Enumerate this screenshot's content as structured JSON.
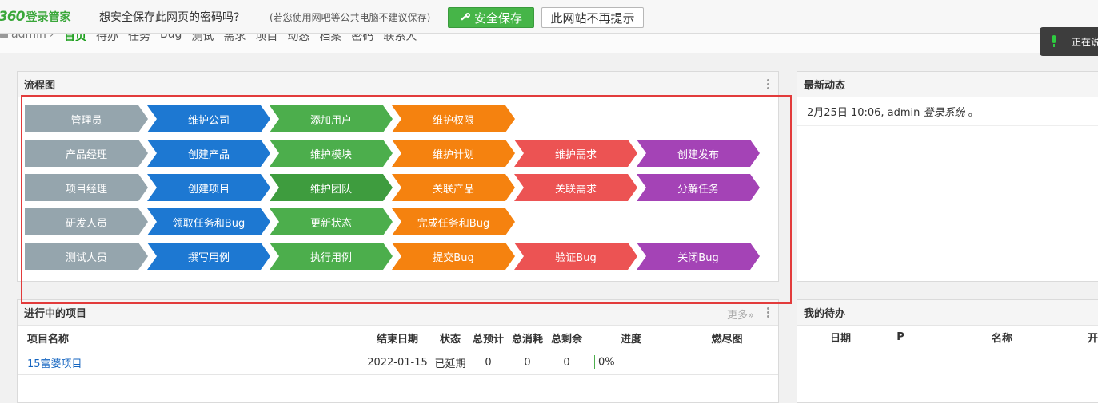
{
  "password_bar": {
    "logo_num": "360",
    "logo_text": "登录管家",
    "ask": "想安全保存此网页的密码吗?",
    "hint": "(若您使用网吧等公共电脑不建议保存)",
    "save_label": "安全保存",
    "never_label": "此网站不再提示"
  },
  "voice_widget": {
    "text": "正在说"
  },
  "nav": {
    "user": "admin",
    "separator": "›",
    "items": [
      "首页",
      "待办",
      "任务",
      "Bug",
      "测试",
      "需求",
      "项目",
      "动态",
      "档案",
      "密码",
      "联系人"
    ]
  },
  "flow_panel": {
    "title": "流程图",
    "rows": [
      {
        "steps": [
          {
            "label": "管理员",
            "color": "gray"
          },
          {
            "label": "维护公司",
            "color": "blue"
          },
          {
            "label": "添加用户",
            "color": "green"
          },
          {
            "label": "维护权限",
            "color": "orange"
          }
        ]
      },
      {
        "steps": [
          {
            "label": "产品经理",
            "color": "gray"
          },
          {
            "label": "创建产品",
            "color": "blue"
          },
          {
            "label": "维护模块",
            "color": "green"
          },
          {
            "label": "维护计划",
            "color": "orange"
          },
          {
            "label": "维护需求",
            "color": "red"
          },
          {
            "label": "创建发布",
            "color": "purple"
          }
        ]
      },
      {
        "steps": [
          {
            "label": "项目经理",
            "color": "gray"
          },
          {
            "label": "创建项目",
            "color": "blue"
          },
          {
            "label": "维护团队",
            "color": "dgreen"
          },
          {
            "label": "关联产品",
            "color": "orange"
          },
          {
            "label": "关联需求",
            "color": "red"
          },
          {
            "label": "分解任务",
            "color": "purple"
          }
        ]
      },
      {
        "steps": [
          {
            "label": "研发人员",
            "color": "gray"
          },
          {
            "label": "领取任务和Bug",
            "color": "blue"
          },
          {
            "label": "更新状态",
            "color": "green"
          },
          {
            "label": "完成任务和Bug",
            "color": "orange"
          }
        ]
      },
      {
        "steps": [
          {
            "label": "测试人员",
            "color": "gray"
          },
          {
            "label": "撰写用例",
            "color": "blue"
          },
          {
            "label": "执行用例",
            "color": "green"
          },
          {
            "label": "提交Bug",
            "color": "orange"
          },
          {
            "label": "验证Bug",
            "color": "red"
          },
          {
            "label": "关闭Bug",
            "color": "purple"
          }
        ]
      }
    ]
  },
  "activity_panel": {
    "title": "最新动态",
    "entry_time": "2月25日 10:06, admin",
    "entry_action": "登录系统",
    "entry_end": "。"
  },
  "projects_panel": {
    "title": "进行中的项目",
    "more": "更多»",
    "columns": {
      "name": "项目名称",
      "end": "结束日期",
      "status": "状态",
      "estimate": "总预计",
      "consumed": "总消耗",
      "left": "总剩余",
      "progress": "进度",
      "burn": "燃尽图"
    },
    "rows": [
      {
        "name": "15富婆项目",
        "end": "2022-01-15",
        "status": "已延期",
        "estimate": "0",
        "consumed": "0",
        "left": "0",
        "progress": "0%"
      }
    ]
  },
  "todo_panel": {
    "title": "我的待办",
    "columns": {
      "date": "日期",
      "pri": "P",
      "name": "名称",
      "extra": "开"
    }
  },
  "colors": {
    "gray": "#95a5ad",
    "blue": "#1d78d2",
    "green": "#4cae4c",
    "dgreen": "#3e9c3e",
    "orange": "#f5820f",
    "red": "#ec5353",
    "purple": "#a443b6",
    "highlight": "#e23b3b"
  },
  "icons": [
    "key-icon",
    "microphone-icon",
    "user-icon",
    "kebab-icon"
  ]
}
